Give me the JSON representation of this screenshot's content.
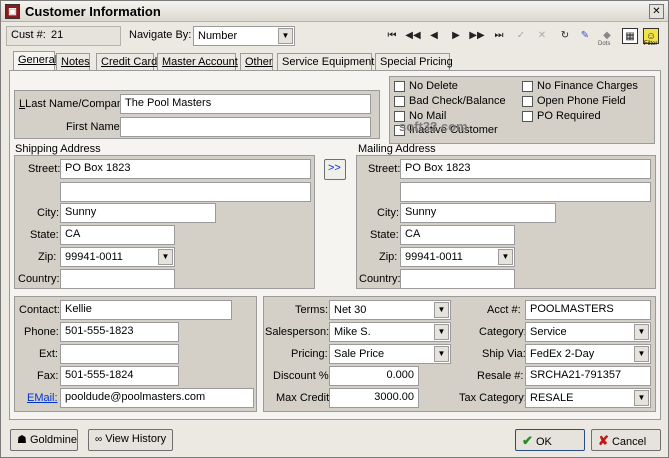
{
  "window": {
    "title": "Customer Information"
  },
  "header": {
    "cust_label": "Cust #:",
    "cust_value": "21",
    "navigate_label": "Navigate By:",
    "navigate_value": "Number"
  },
  "tabs": [
    "General",
    "Notes",
    "Credit Card",
    "Master Account",
    "Other",
    "Service Equipment",
    "Special Pricing"
  ],
  "name": {
    "last_label": "Last Name/Company:",
    "last_value": "The Pool Masters",
    "first_label": "First Name:",
    "first_value": ""
  },
  "flags": {
    "no_delete": "No Delete",
    "bad_check": "Bad Check/Balance",
    "no_mail": "No Mail",
    "inactive": "Inactive Customer",
    "no_finance": "No Finance Charges",
    "open_phone": "Open Phone Field",
    "po_required": "PO Required"
  },
  "watermark": "soft32.com",
  "shipping": {
    "title": "Shipping Address",
    "street_label": "Street:",
    "street1": "PO Box 1823",
    "street2": "",
    "city_label": "City:",
    "city": "Sunny",
    "state_label": "State:",
    "state": "CA",
    "zip_label": "Zip:",
    "zip": "99941-0011",
    "country_label": "Country:",
    "country": ""
  },
  "copy_button": ">>",
  "mailing": {
    "title": "Mailing Address",
    "street_label": "Street:",
    "street1": "PO Box 1823",
    "street2": "",
    "city_label": "City:",
    "city": "Sunny",
    "state_label": "State:",
    "state": "CA",
    "zip_label": "Zip:",
    "zip": "99941-0011",
    "country_label": "Country:",
    "country": ""
  },
  "contact": {
    "contact_label": "Contact:",
    "contact": "Kellie",
    "phone_label": "Phone:",
    "phone": "501-555-1823",
    "ext_label": "Ext:",
    "ext": "",
    "fax_label": "Fax:",
    "fax": "501-555-1824",
    "email_label": "EMail:",
    "email": "pooldude@poolmasters.com"
  },
  "account": {
    "terms_label": "Terms:",
    "terms": "Net 30",
    "salesperson_label": "Salesperson:",
    "salesperson": "Mike S.",
    "pricing_label": "Pricing:",
    "pricing": "Sale Price",
    "discount_label": "Discount %:",
    "discount": "0.000",
    "maxcredit_label": "Max Credit:",
    "maxcredit": "3000.00",
    "acct_label": "Acct #:",
    "acct": "POOLMASTERS",
    "category_label": "Category:",
    "category": "Service",
    "shipvia_label": "Ship Via:",
    "shipvia": "FedEx 2-Day",
    "resale_label": "Resale #:",
    "resale": "SRCHA21-791357",
    "taxcat_label": "Tax Category:",
    "taxcat": "RESALE"
  },
  "footer": {
    "goldmine": "Goldmine",
    "view_history": "View History",
    "ok": "OK",
    "cancel": "Cancel"
  },
  "toolbar": {
    "dots_label": "Dots",
    "filter_label": "Filter"
  },
  "colors": {
    "accent_green": "#2a8a2a",
    "accent_red": "#c01818",
    "link_blue": "#0033cc"
  }
}
